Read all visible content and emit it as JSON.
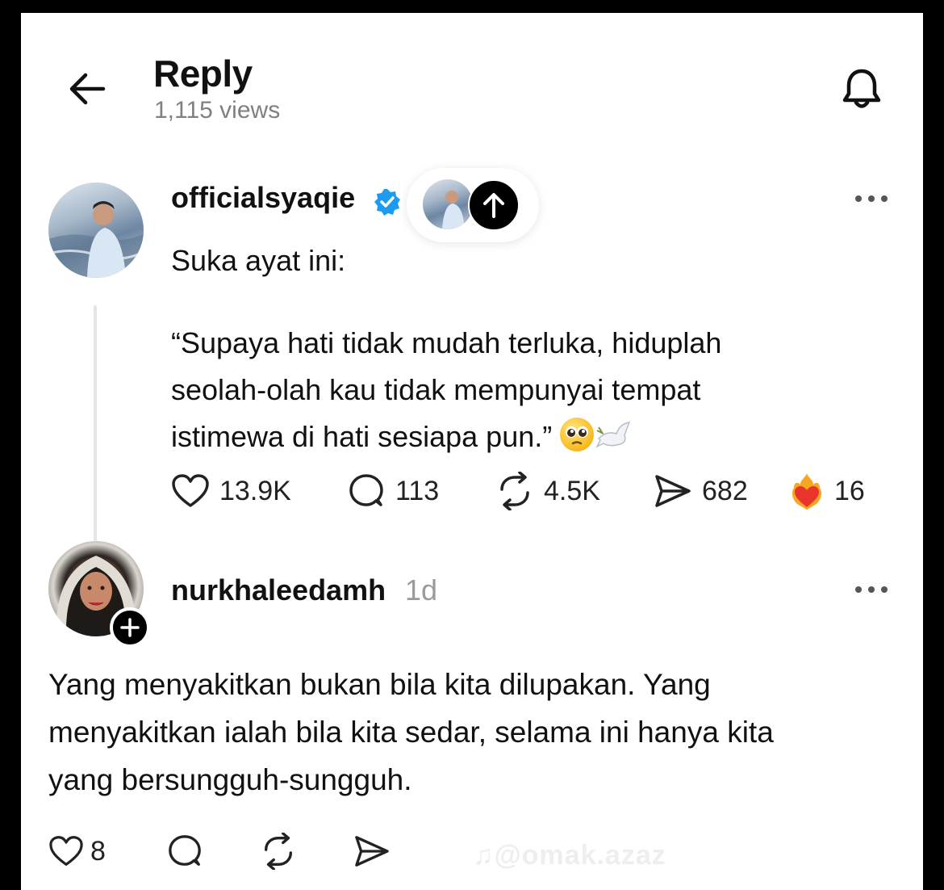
{
  "header": {
    "title": "Reply",
    "views": "1,115 views"
  },
  "post": {
    "username": "officialsyaqie",
    "verified": true,
    "line1": "Suka ayat ini:",
    "quote_line1": "“Supaya hati tidak mudah terluka, hiduplah",
    "quote_line2": "seolah-olah kau tidak mempunyai tempat",
    "quote_line3": "istimewa di hati sesiapa pun.”",
    "emojis": [
      "pleading-face",
      "dove"
    ],
    "stats": {
      "likes": "13.9K",
      "comments": "113",
      "reposts": "4.5K",
      "shares": "682",
      "fire_hearts": "16"
    }
  },
  "reply": {
    "username": "nurkhaleedamh",
    "time": "1d",
    "line1": "Yang menyakitkan bukan bila kita dilupakan. Yang",
    "line2": "menyakitkan ialah bila kita sedar, selama ini hanya kita",
    "line3": "yang bersungguh-sungguh.",
    "likes": "8"
  },
  "watermark": "@omak.azaz",
  "colors": {
    "verified_blue": "#1d9bf0",
    "muted_text": "#808080",
    "fire_heart": "#e8342b"
  }
}
